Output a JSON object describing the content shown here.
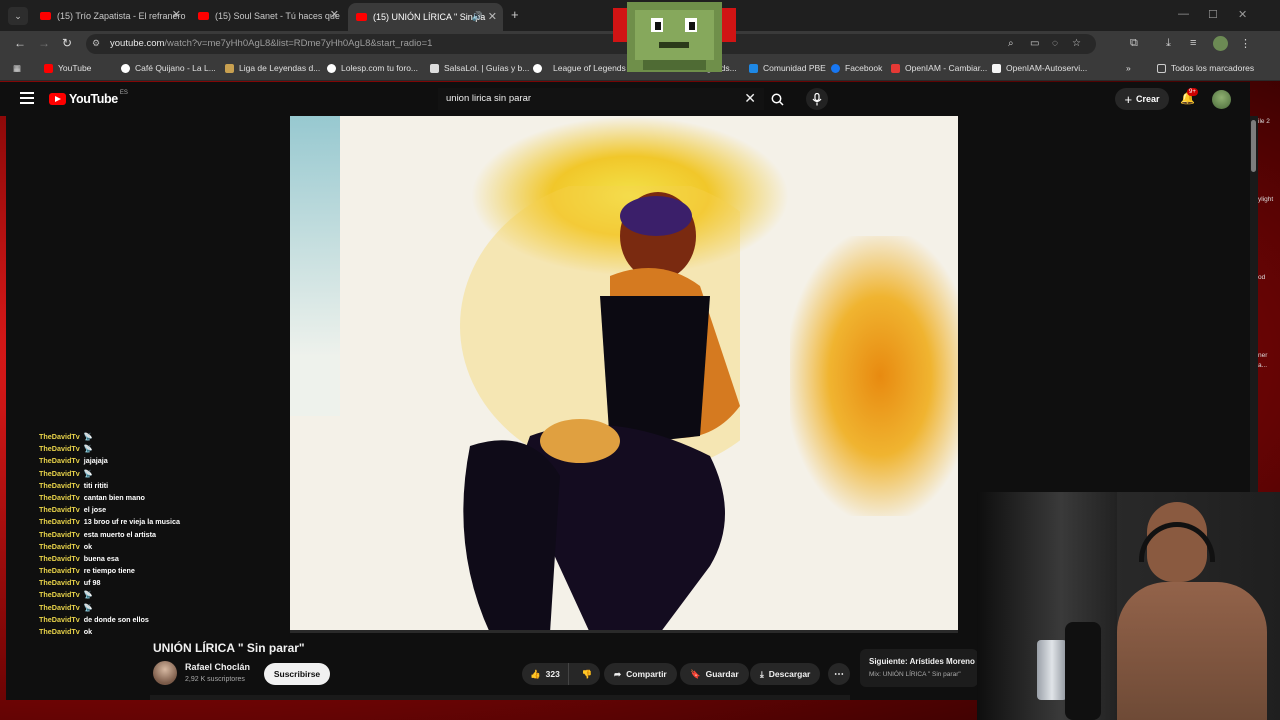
{
  "browser": {
    "tabs": [
      {
        "label": "(15) Trío Zapatista - El refranero",
        "active": false
      },
      {
        "label": "(15) Soul Sanet - Tú haces que",
        "active": false
      },
      {
        "label": "(15) UNIÓN LÍRICA \" Sin pa",
        "active": true
      }
    ],
    "url_host": "youtube.com",
    "url_path": "/watch?v=me7yHh0AgL8&list=RDme7yHh0AgL8&start_radio=1",
    "bookmarks": [
      {
        "label": "YouTube",
        "color": "#ff0000"
      },
      {
        "label": "Café Quijano - La L...",
        "color": "#ffffff"
      },
      {
        "label": "Liga de Leyendas d...",
        "color": "#c8a050"
      },
      {
        "label": "Lolesp.com tu foro...",
        "color": "#ffffff"
      },
      {
        "label": "SalsaLol. | Guías y b...",
        "color": "#dddddd"
      },
      {
        "label": "League of Legends",
        "color": "#ffffff"
      },
      {
        "label": "Legends...",
        "color": "#444444"
      },
      {
        "label": "Comunidad PBE",
        "color": "#1e88e5"
      },
      {
        "label": "Facebook",
        "color": "#1877f2"
      },
      {
        "label": "OpenIAM - Cambiar...",
        "color": "#e53935"
      },
      {
        "label": "OpenIAM-Autoservi...",
        "color": "#f5f5f5"
      }
    ],
    "all_bookmarks": "Todos los marcadores"
  },
  "youtube": {
    "logo": "YouTube",
    "region": "ES",
    "search_query": "union lirica sin parar",
    "create_label": "Crear",
    "notif_badge": "9+",
    "video_title": "UNIÓN LÍRICA \" Sin parar\"",
    "channel_name": "Rafael Choclán",
    "subscribers": "2,92 K suscriptores",
    "subscribe_label": "Suscribirse",
    "likes": "323",
    "share_label": "Compartir",
    "save_label": "Guardar",
    "download_label": "Descargar",
    "next_title": "Siguiente: Arístides Moreno",
    "next_subtitle": "Mix: UNIÓN LÍRICA \" Sin parar\""
  },
  "chat": [
    {
      "user": "TheDavidTv",
      "msg": "📡"
    },
    {
      "user": "TheDavidTv",
      "msg": "📡"
    },
    {
      "user": "TheDavidTv",
      "msg": "jajajaja"
    },
    {
      "user": "TheDavidTv",
      "msg": "📡"
    },
    {
      "user": "TheDavidTv",
      "msg": "titi rititi"
    },
    {
      "user": "TheDavidTv",
      "msg": "cantan bien mano"
    },
    {
      "user": "TheDavidTv",
      "msg": "el jose"
    },
    {
      "user": "TheDavidTv",
      "msg": "13 broo uf re vieja la musica"
    },
    {
      "user": "TheDavidTv",
      "msg": "esta muerto el artista"
    },
    {
      "user": "TheDavidTv",
      "msg": "ok"
    },
    {
      "user": "TheDavidTv",
      "msg": "buena esa"
    },
    {
      "user": "TheDavidTv",
      "msg": "re tiempo tiene"
    },
    {
      "user": "TheDavidTv",
      "msg": "uf 98"
    },
    {
      "user": "TheDavidTv",
      "msg": "📡"
    },
    {
      "user": "TheDavidTv",
      "msg": "📡"
    },
    {
      "user": "TheDavidTv",
      "msg": "de donde son ellos"
    },
    {
      "user": "TheDavidTv",
      "msg": "ok"
    }
  ],
  "edge_fragments": [
    "ile 2",
    "ylight",
    "od",
    "ner",
    "a..."
  ],
  "colors": {
    "accent": "#ff0000",
    "chat_user": "#e8d34a",
    "frame": "#b01010"
  }
}
